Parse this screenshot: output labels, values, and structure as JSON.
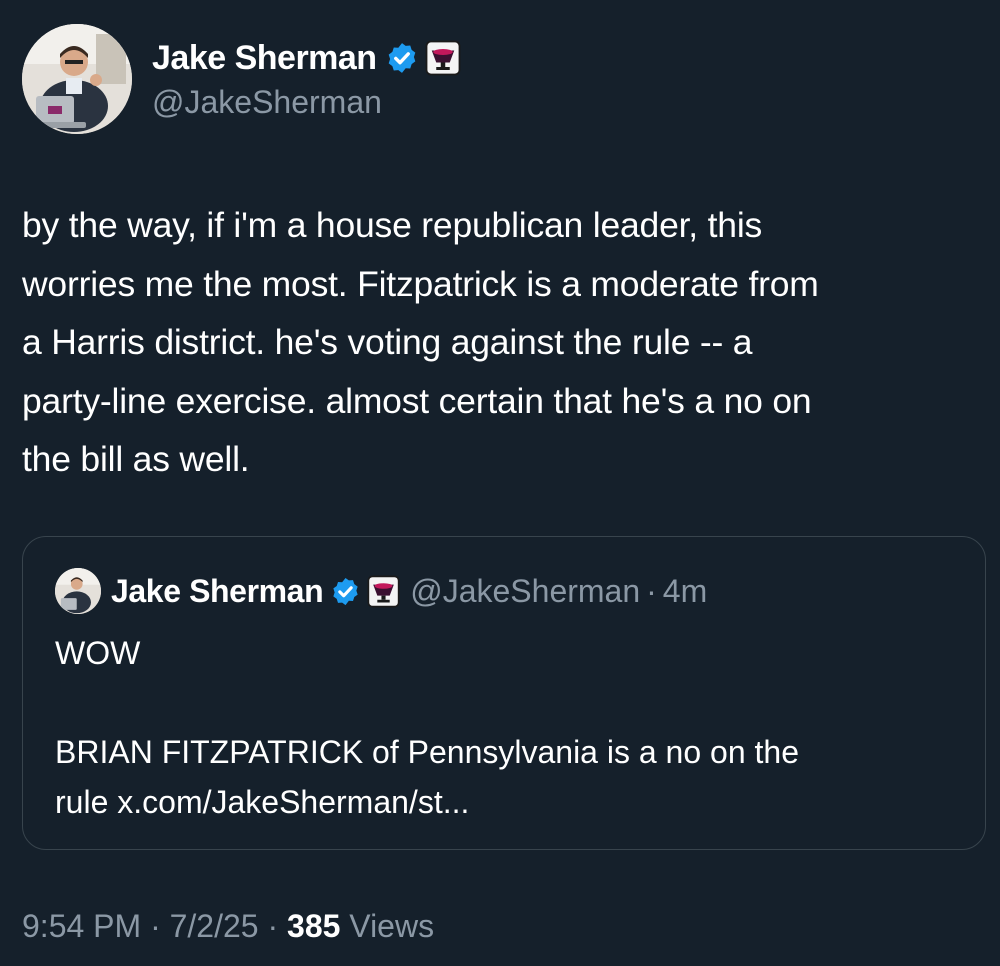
{
  "colors": {
    "background": "#15202b",
    "text": "#ffffff",
    "muted": "#8b98a5",
    "border": "#38444d",
    "verified": "#1d9bf0"
  },
  "tweet": {
    "author": {
      "name": "Jake Sherman",
      "handle": "@JakeSherman",
      "verified_icon": "verified-badge-icon",
      "affiliation_icon": "punchbowl-icon"
    },
    "text": "by the way, if i'm a house republican leader, this\nworries me the most. Fitzpatrick is a moderate from\na Harris district. he's voting against the rule -- a\nparty-line exercise. almost certain that he's a no on\nthe bill as well.",
    "quoted": {
      "name": "Jake Sherman",
      "handle": "@JakeSherman",
      "separator": "·",
      "time": "4m",
      "text": "WOW\n\nBRIAN FITZPATRICK of Pennsylvania is a no on the\nrule x.com/JakeSherman/st..."
    },
    "meta": {
      "time": "9:54 PM",
      "separator": "·",
      "date": "7/2/25",
      "views_count": "385",
      "views_label": "Views"
    }
  }
}
